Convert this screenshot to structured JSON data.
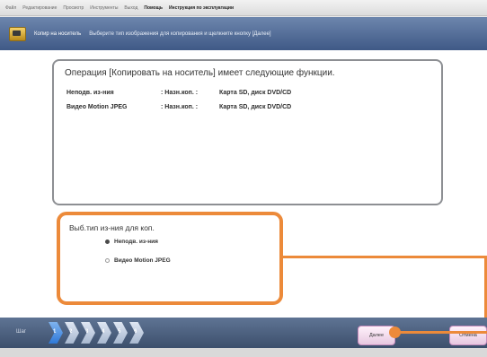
{
  "menu": [
    "Файл",
    "Редактирование",
    "Просмотр",
    "Инструменты",
    "Выход",
    "Помощь",
    "Инструкция по эксплуатации"
  ],
  "menu_bold_from": 5,
  "titlebar": {
    "name": "Копир на носитель",
    "instruction": "Выберите тип изображения для копирования и щелкните кнопку [Далее]"
  },
  "info": {
    "heading": "Операция [Копировать на носитель] имеет следующие функции.",
    "rows": [
      {
        "type": "Неподв. из-ния",
        "label": ": Назн.коп. :",
        "target": "Карта SD, диск DVD/CD"
      },
      {
        "type": "Видео Motion JPEG",
        "label": ": Назн.коп. :",
        "target": "Карта SD, диск DVD/CD"
      }
    ]
  },
  "image_type": {
    "heading": "Выб.тип из-ния для коп.",
    "options": [
      {
        "label": "Неподв. из-ния",
        "selected": true
      },
      {
        "label": "Видео Motion JPEG",
        "selected": false
      }
    ]
  },
  "steps": {
    "label": "Шаг",
    "items": [
      "1",
      "2",
      "3",
      "4",
      "5",
      "6"
    ],
    "active_index": 0
  },
  "buttons": {
    "next": "Далее",
    "cancel": "Отмена"
  },
  "colors": {
    "highlight": "#ec8a3a",
    "title_bar": "#4d6891",
    "active_step": "#2f79d8"
  }
}
